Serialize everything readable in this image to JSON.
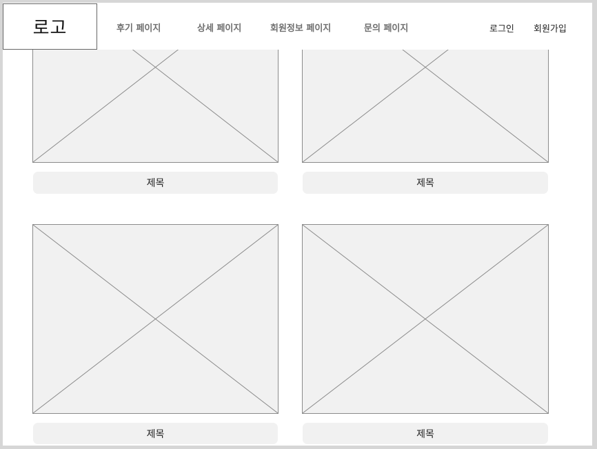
{
  "header": {
    "logo": "로고",
    "nav": [
      {
        "label": "후기 페이지"
      },
      {
        "label": "상세 페이지"
      },
      {
        "label": "회원정보 페이지"
      },
      {
        "label": "문의 페이지"
      }
    ],
    "auth": {
      "login": "로그인",
      "signup": "회원가입"
    }
  },
  "cards": [
    {
      "title": "제목"
    },
    {
      "title": "제목"
    },
    {
      "title": "제목"
    },
    {
      "title": "제목"
    }
  ]
}
